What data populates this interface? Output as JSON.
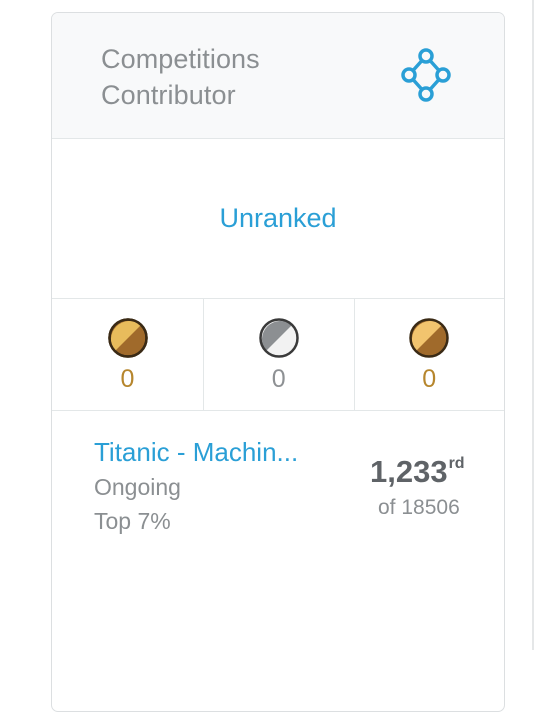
{
  "profile": {
    "category": "Competitions",
    "tier": "Contributor",
    "tier_icon": "network-nodes-icon",
    "rank": "Unranked"
  },
  "medals": [
    {
      "type": "gold",
      "icon": "gold-medal-icon",
      "count": "0",
      "color": "#b6862d"
    },
    {
      "type": "silver",
      "icon": "silver-medal-icon",
      "count": "0",
      "color": "#8e9194"
    },
    {
      "type": "bronze",
      "icon": "bronze-medal-icon",
      "count": "0",
      "color": "#b6862d"
    }
  ],
  "competitions": [
    {
      "title": "Titanic - Machin...",
      "status": "Ongoing",
      "percentile": "Top 7%",
      "rank": "1,233",
      "rank_suffix": "rd",
      "total": "of 18506"
    }
  ],
  "colors": {
    "accent": "#2a9fd6",
    "muted_text": "#8b8f92",
    "rank_text": "#5f6367"
  }
}
